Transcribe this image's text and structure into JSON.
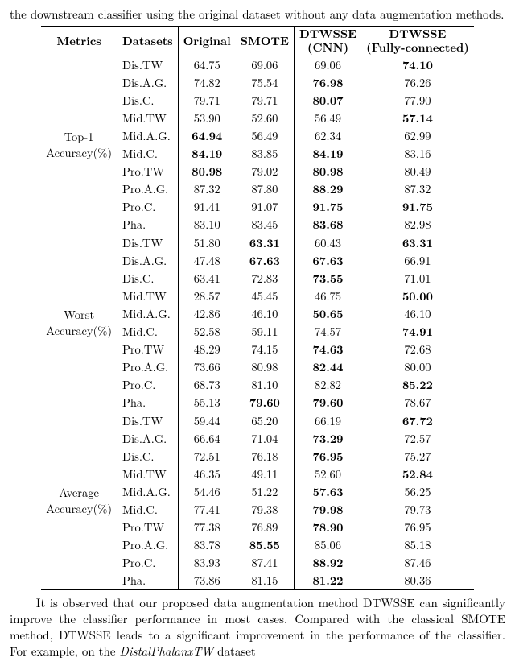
{
  "top_fragment": "the downstream classifier using the original dataset without any data augmentation methods.",
  "bottom_paragraph_a": "It is observed that our proposed data augmentation method DTWSSE can significantly improve the classifier performance in most cases. Compared with the classical SMOTE method, DTWSSE leads to a significant improvement in the performance of the classifier. For example, on the ",
  "bottom_italic": "DistalPhalanxTW",
  "bottom_paragraph_b": " dataset",
  "headers": {
    "metrics": "Metrics",
    "datasets": "Datasets",
    "original": "Original",
    "smote": "SMOTE",
    "cnn_top": "DTWSSE",
    "cnn_bot": "(CNN)",
    "fc_top": "DTWSSE",
    "fc_bot": "(Fully-connected)"
  },
  "chart_data": {
    "type": "table",
    "blocks": [
      {
        "metric": [
          "Top-1",
          "Accuracy(%)"
        ],
        "rows": [
          {
            "ds": "Dis.TW",
            "orig": "64.75",
            "smote": "69.06",
            "cnn": "69.06",
            "fc": "74.10",
            "bold": "fc"
          },
          {
            "ds": "Dis.A.G.",
            "orig": "74.82",
            "smote": "75.54",
            "cnn": "76.98",
            "fc": "76.26",
            "bold": "cnn"
          },
          {
            "ds": "Dis.C.",
            "orig": "79.71",
            "smote": "79.71",
            "cnn": "80.07",
            "fc": "77.90",
            "bold": "cnn"
          },
          {
            "ds": "Mid.TW",
            "orig": "53.90",
            "smote": "52.60",
            "cnn": "56.49",
            "fc": "57.14",
            "bold": "fc"
          },
          {
            "ds": "Mid.A.G.",
            "orig": "64.94",
            "smote": "56.49",
            "cnn": "62.34",
            "fc": "62.99",
            "bold": "orig"
          },
          {
            "ds": "Mid.C.",
            "orig": "84.19",
            "smote": "83.85",
            "cnn": "84.19",
            "fc": "83.16",
            "bold": "orig,cnn"
          },
          {
            "ds": "Pro.TW",
            "orig": "80.98",
            "smote": "79.02",
            "cnn": "80.98",
            "fc": "80.49",
            "bold": "orig,cnn"
          },
          {
            "ds": "Pro.A.G.",
            "orig": "87.32",
            "smote": "87.80",
            "cnn": "88.29",
            "fc": "87.32",
            "bold": "cnn"
          },
          {
            "ds": "Pro.C.",
            "orig": "91.41",
            "smote": "91.07",
            "cnn": "91.75",
            "fc": "91.75",
            "bold": "cnn,fc"
          },
          {
            "ds": "Pha.",
            "orig": "83.10",
            "smote": "83.45",
            "cnn": "83.68",
            "fc": "82.98",
            "bold": "cnn"
          }
        ]
      },
      {
        "metric": [
          "Worst",
          "Accuracy(%)"
        ],
        "rows": [
          {
            "ds": "Dis.TW",
            "orig": "51.80",
            "smote": "63.31",
            "cnn": "60.43",
            "fc": "63.31",
            "bold": "smote,fc"
          },
          {
            "ds": "Dis.A.G.",
            "orig": "47.48",
            "smote": "67.63",
            "cnn": "67.63",
            "fc": "66.91",
            "bold": "smote,cnn"
          },
          {
            "ds": "Dis.C.",
            "orig": "63.41",
            "smote": "72.83",
            "cnn": "73.55",
            "fc": "71.01",
            "bold": "cnn"
          },
          {
            "ds": "Mid.TW",
            "orig": "28.57",
            "smote": "45.45",
            "cnn": "46.75",
            "fc": "50.00",
            "bold": "fc"
          },
          {
            "ds": "Mid.A.G.",
            "orig": "42.86",
            "smote": "46.10",
            "cnn": "50.65",
            "fc": "46.10",
            "bold": "cnn"
          },
          {
            "ds": "Mid.C.",
            "orig": "52.58",
            "smote": "59.11",
            "cnn": "74.57",
            "fc": "74.91",
            "bold": "fc"
          },
          {
            "ds": "Pro.TW",
            "orig": "48.29",
            "smote": "74.15",
            "cnn": "74.63",
            "fc": "72.68",
            "bold": "cnn"
          },
          {
            "ds": "Pro.A.G.",
            "orig": "73.66",
            "smote": "80.98",
            "cnn": "82.44",
            "fc": "80.00",
            "bold": "cnn"
          },
          {
            "ds": "Pro.C.",
            "orig": "68.73",
            "smote": "81.10",
            "cnn": "82.82",
            "fc": "85.22",
            "bold": "fc"
          },
          {
            "ds": "Pha.",
            "orig": "55.13",
            "smote": "79.60",
            "cnn": "79.60",
            "fc": "78.67",
            "bold": "smote,cnn"
          }
        ]
      },
      {
        "metric": [
          "Average",
          "Accuracy(%)"
        ],
        "rows": [
          {
            "ds": "Dis.TW",
            "orig": "59.44",
            "smote": "65.20",
            "cnn": "66.19",
            "fc": "67.72",
            "bold": "fc"
          },
          {
            "ds": "Dis.A.G.",
            "orig": "66.64",
            "smote": "71.04",
            "cnn": "73.29",
            "fc": "72.57",
            "bold": "cnn"
          },
          {
            "ds": "Dis.C.",
            "orig": "72.51",
            "smote": "76.18",
            "cnn": "76.95",
            "fc": "75.27",
            "bold": "cnn"
          },
          {
            "ds": "Mid.TW",
            "orig": "46.35",
            "smote": "49.11",
            "cnn": "52.60",
            "fc": "52.84",
            "bold": "fc"
          },
          {
            "ds": "Mid.A.G.",
            "orig": "54.46",
            "smote": "51.22",
            "cnn": "57.63",
            "fc": "56.25",
            "bold": "cnn"
          },
          {
            "ds": "Mid.C.",
            "orig": "77.41",
            "smote": "79.38",
            "cnn": "79.98",
            "fc": "79.73",
            "bold": "cnn"
          },
          {
            "ds": "Pro.TW",
            "orig": "77.38",
            "smote": "76.89",
            "cnn": "78.90",
            "fc": "76.95",
            "bold": "cnn"
          },
          {
            "ds": "Pro.A.G.",
            "orig": "83.78",
            "smote": "85.55",
            "cnn": "85.06",
            "fc": "85.18",
            "bold": "smote"
          },
          {
            "ds": "Pro.C.",
            "orig": "83.93",
            "smote": "87.41",
            "cnn": "88.92",
            "fc": "87.46",
            "bold": "cnn"
          },
          {
            "ds": "Pha.",
            "orig": "73.86",
            "smote": "81.15",
            "cnn": "81.22",
            "fc": "80.36",
            "bold": "cnn"
          }
        ]
      }
    ]
  }
}
